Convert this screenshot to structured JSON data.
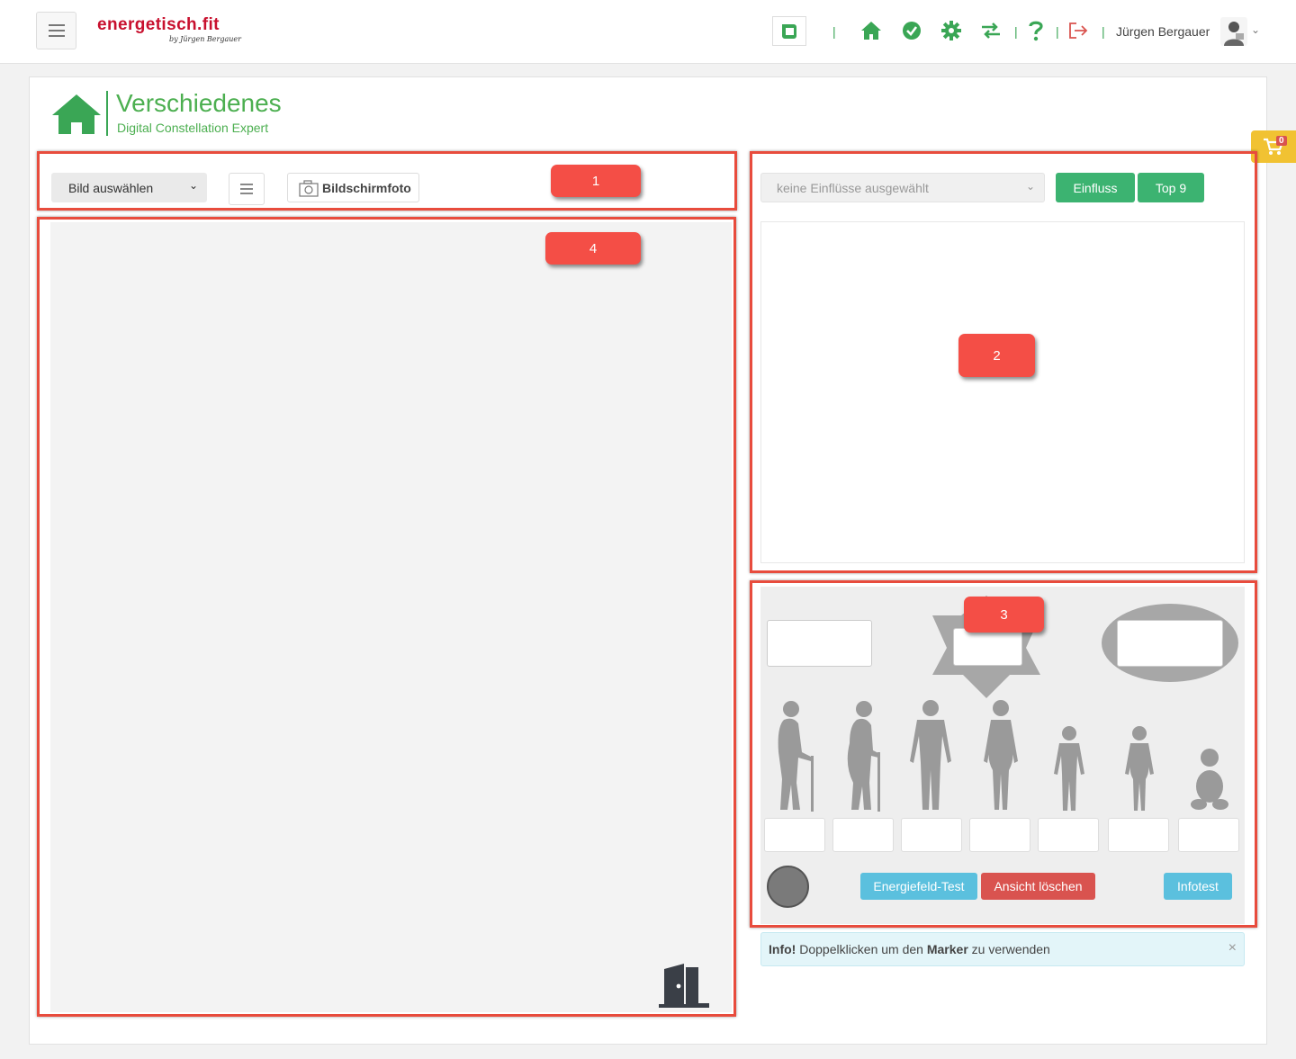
{
  "topbar": {
    "brand": "energetisch.fit",
    "brand_sub": "by Jürgen Bergauer",
    "user_name": "Jürgen Bergauer",
    "separator": "|",
    "nav_icons": [
      "home-icon",
      "check-circle-icon",
      "gear-icon",
      "swap-arrows-icon",
      "help-icon",
      "logout-icon"
    ]
  },
  "header": {
    "title": "Verschiedenes",
    "subtitle": "Digital Constellation Expert"
  },
  "cart": {
    "count": "0"
  },
  "toolbar": {
    "image_select": "Bild auswählen",
    "screenshot_label": "Bildschirmfoto"
  },
  "influence": {
    "select_placeholder": "keine Einflüsse ausgewählt",
    "einfluss_label": "Einfluss",
    "top9_label": "Top 9"
  },
  "constellation": {
    "energy_test_label": "Energiefeld-Test",
    "clear_label": "Ansicht löschen",
    "infotest_label": "Infotest"
  },
  "alert": {
    "bold_prefix": "Info!",
    "text_before": "Doppelklicken um den",
    "bold_word": "Marker",
    "text_after": "zu verwenden",
    "close": "×"
  },
  "highlights": [
    "1",
    "2",
    "3",
    "4"
  ],
  "colors": {
    "accent_green": "#3cb371",
    "brand_red": "#c8102e",
    "highlight_red": "#f44e46",
    "danger": "#d9534f",
    "info": "#5bc0de"
  }
}
